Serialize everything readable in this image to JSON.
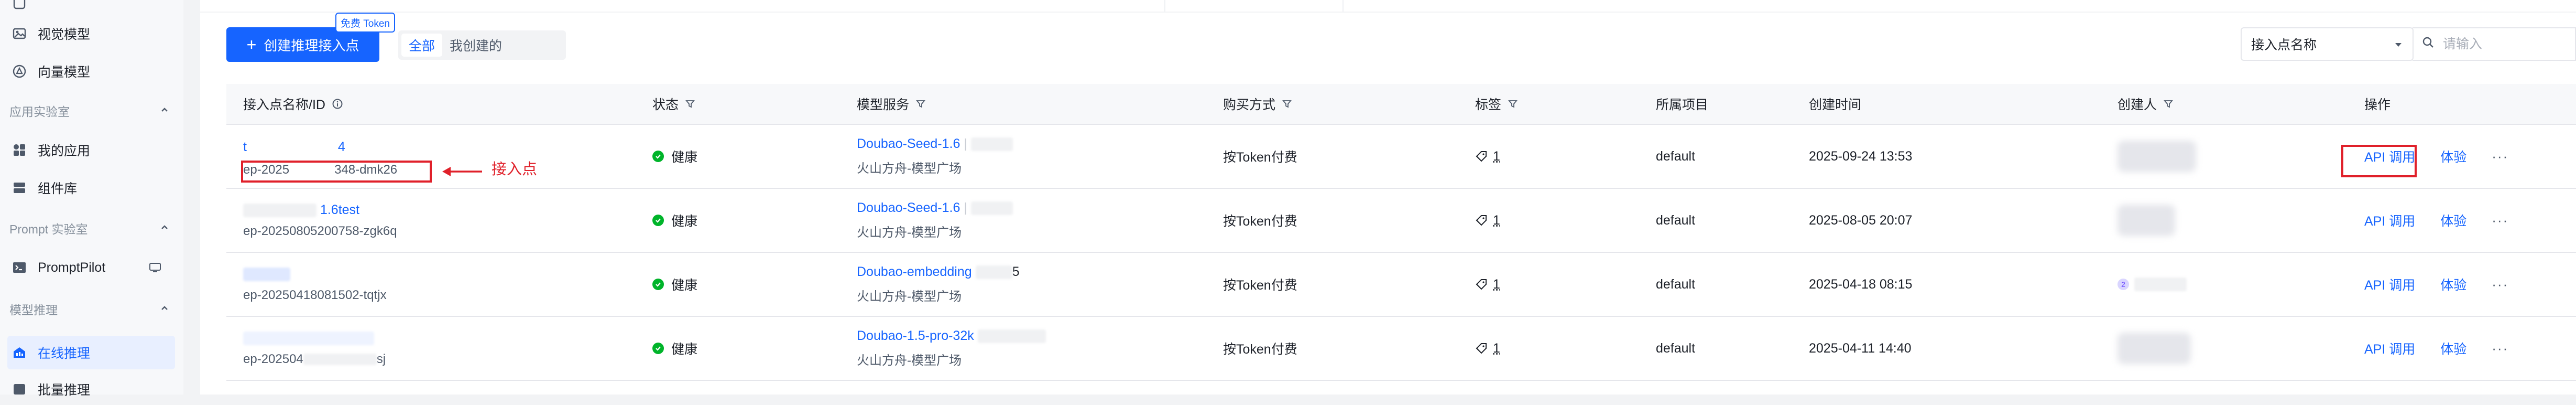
{
  "sidebar": {
    "items": [
      {
        "label": "视觉模型",
        "icon": "image-icon"
      },
      {
        "label": "向量模型",
        "icon": "vector-icon"
      },
      {
        "group": "应用实验室"
      },
      {
        "label": "我的应用",
        "icon": "apps-icon"
      },
      {
        "label": "组件库",
        "icon": "component-icon"
      },
      {
        "group": "Prompt 实验室"
      },
      {
        "label": "PromptPilot",
        "icon": "terminal-icon"
      },
      {
        "group": "模型推理"
      },
      {
        "label": "在线推理",
        "icon": "inference-icon",
        "active": true
      },
      {
        "label": "批量推理",
        "icon": "batch-icon"
      }
    ]
  },
  "toolbar": {
    "create_label": "创建推理接入点",
    "free_tag": "免费 Token",
    "filter_all": "全部",
    "filter_mine": "我创建的",
    "select_value": "接入点名称",
    "search_placeholder": "请输入"
  },
  "table": {
    "headers": {
      "name": "接入点名称/ID",
      "status": "状态",
      "model": "模型服务",
      "purchase": "购买方式",
      "tags": "标签",
      "project": "所属项目",
      "created": "创建时间",
      "creator": "创建人",
      "ops": "操作"
    },
    "rows": [
      {
        "name": "t",
        "name_tail": "4",
        "id_head": "ep-2025",
        "id_tail": "348-dmk26",
        "status": "健康",
        "model": "Doubao-Seed-1.6",
        "model_source": "火山方舟-模型广场",
        "purchase": "按Token付费",
        "tags": "1",
        "project": "default",
        "created": "2025-09-24 13:53",
        "op_api": "API 调用",
        "op_try": "体验",
        "op_more": "···"
      },
      {
        "name": "",
        "name_tail": "1.6test",
        "id": "ep-20250805200758-zgk6q",
        "status": "健康",
        "model": "Doubao-Seed-1.6",
        "model_source": "火山方舟-模型广场",
        "purchase": "按Token付费",
        "tags": "1",
        "project": "default",
        "created": "2025-08-05 20:07",
        "op_api": "API 调用",
        "op_try": "体验",
        "op_more": "···"
      },
      {
        "name": "",
        "id": "ep-20250418081502-tqtjx",
        "status": "健康",
        "model": "Doubao-embedding",
        "model_tail": "5",
        "model_source": "火山方舟-模型广场",
        "purchase": "按Token付费",
        "tags": "1",
        "project": "default",
        "created": "2025-04-18 08:15",
        "creator_mini": "2",
        "op_api": "API 调用",
        "op_try": "体验",
        "op_more": "···"
      },
      {
        "name": "",
        "id_head": "ep-202504",
        "id_tail": "sj",
        "status": "健康",
        "model": "Doubao-1.5-pro-32k",
        "model_source": "火山方舟-模型广场",
        "purchase": "按Token付费",
        "tags": "1",
        "project": "default",
        "created": "2025-04-11 14:40",
        "op_api": "API 调用",
        "op_try": "体验",
        "op_more": "···"
      }
    ]
  },
  "annotation": {
    "label": "接入点",
    "color": "#e0202a"
  },
  "colors": {
    "accent": "#1664ff",
    "healthy": "#00b42a",
    "annotation": "#e0202a"
  }
}
